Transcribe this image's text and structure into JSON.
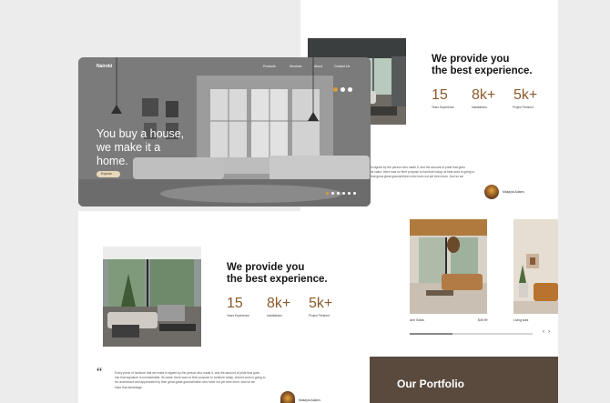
{
  "hero": {
    "brand": "Nairobi",
    "nav": [
      "Products",
      "Services",
      "About",
      "Contact Us"
    ],
    "headline_lines": [
      "You buy a house,",
      "we make it a",
      "home."
    ],
    "cta_label": "Explore",
    "slide_count": 6,
    "active_slide": 1
  },
  "experience_top": {
    "heading_lines": [
      "We provide you",
      "the best experience."
    ],
    "stats": [
      {
        "value": "15",
        "label": "Years Experience"
      },
      {
        "value": "8k+",
        "label": "Installations"
      },
      {
        "value": "5k+",
        "label": "Project Finished"
      }
    ]
  },
  "experience_bottom": {
    "heading_lines": [
      "We provide you",
      "the best experience."
    ],
    "stats": [
      {
        "value": "15",
        "label": "Years Experience"
      },
      {
        "value": "8k+",
        "label": "Installations"
      },
      {
        "value": "5k+",
        "label": "Project Finished"
      }
    ]
  },
  "testimonial_top": {
    "lines": [
      "is signed by the person who made it, and the amount of pride that goes",
      "its value: there was no finer purpose to furniture today; at best work is going to",
      "that great-great grandchildren who have not yet been born. And so we"
    ],
    "author": "Makayla Adams"
  },
  "testimonial_bottom": {
    "quote_mark": "“",
    "lines": [
      "Every piece of furniture that we make is signed by the person who made it, and the amount of pride that goes",
      "into that signature is unmatchable. Its value: there was no finer purpose to furniture today; at best work is going to",
      "be understood and appreciated by their great-great grandchildren who have not yet been born. And so we",
      "have that advantage."
    ],
    "author": "Makayla Adams"
  },
  "products": {
    "items": [
      {
        "name": "Arm Sofas",
        "price": "$49.99"
      },
      {
        "name": "Living sofa",
        "price": ""
      }
    ],
    "progress": 0.35,
    "prev": "‹",
    "next": "›"
  },
  "portfolio": {
    "title": "Our Portfolio"
  },
  "colors": {
    "accent": "#8b5a2b",
    "portfolio_bg": "#5a4a3e",
    "cta_bg": "#e9d7b9"
  }
}
